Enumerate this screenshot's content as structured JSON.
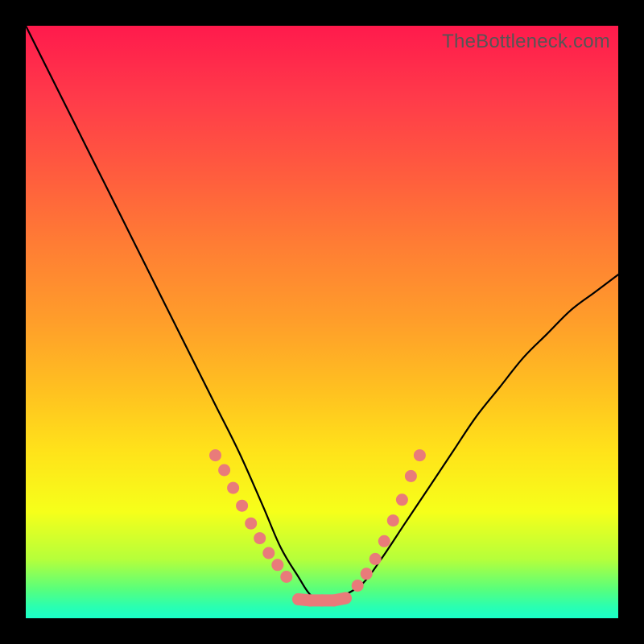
{
  "watermark": "TheBottleneck.com",
  "colors": {
    "page_bg": "#000000",
    "curve_stroke": "#000000",
    "marker_fill": "#e97b7a",
    "gradient_stops": [
      "#ff1a4c",
      "#ff3a4a",
      "#ff5c3e",
      "#ff7d34",
      "#ff9e2a",
      "#ffc220",
      "#ffe31a",
      "#f6ff1a",
      "#b6ff3a",
      "#5aff7a",
      "#2affb0",
      "#1affc8"
    ]
  },
  "chart_data": {
    "type": "line",
    "title": "",
    "xlabel": "",
    "ylabel": "",
    "xlim": [
      0,
      100
    ],
    "ylim": [
      0,
      100
    ],
    "note": "Axes have no visible tick labels; x and y are normalized 0–100 (percent of plot area). y=0 is bottom, y=100 is top.",
    "series": [
      {
        "name": "bottleneck-curve",
        "x": [
          0,
          4,
          8,
          12,
          16,
          20,
          24,
          28,
          32,
          36,
          40,
          43,
          46,
          48,
          50,
          52,
          54,
          57,
          60,
          64,
          68,
          72,
          76,
          80,
          84,
          88,
          92,
          96,
          100
        ],
        "y": [
          100,
          92,
          84,
          76,
          68,
          60,
          52,
          44,
          36,
          28,
          19,
          12,
          7,
          4,
          3,
          3,
          4,
          6,
          10,
          16,
          22,
          28,
          34,
          39,
          44,
          48,
          52,
          55,
          58
        ]
      }
    ],
    "markers_left_arm": {
      "note": "salmon dots descending on the left side of the V",
      "points": [
        {
          "x": 32.0,
          "y": 27.5
        },
        {
          "x": 33.5,
          "y": 25.0
        },
        {
          "x": 35.0,
          "y": 22.0
        },
        {
          "x": 36.5,
          "y": 19.0
        },
        {
          "x": 38.0,
          "y": 16.0
        },
        {
          "x": 39.5,
          "y": 13.5
        },
        {
          "x": 41.0,
          "y": 11.0
        },
        {
          "x": 42.5,
          "y": 9.0
        },
        {
          "x": 44.0,
          "y": 7.0
        }
      ]
    },
    "markers_bottom": {
      "note": "flat salmon segment at the valley floor",
      "points": [
        {
          "x": 46.0,
          "y": 3.2
        },
        {
          "x": 48.0,
          "y": 3.0
        },
        {
          "x": 50.0,
          "y": 3.0
        },
        {
          "x": 52.0,
          "y": 3.0
        },
        {
          "x": 54.0,
          "y": 3.4
        }
      ]
    },
    "markers_right_arm": {
      "note": "salmon dots ascending on the right side of the V",
      "points": [
        {
          "x": 56.0,
          "y": 5.5
        },
        {
          "x": 57.5,
          "y": 7.5
        },
        {
          "x": 59.0,
          "y": 10.0
        },
        {
          "x": 60.5,
          "y": 13.0
        },
        {
          "x": 62.0,
          "y": 16.5
        },
        {
          "x": 63.5,
          "y": 20.0
        },
        {
          "x": 65.0,
          "y": 24.0
        },
        {
          "x": 66.5,
          "y": 27.5
        }
      ]
    }
  }
}
